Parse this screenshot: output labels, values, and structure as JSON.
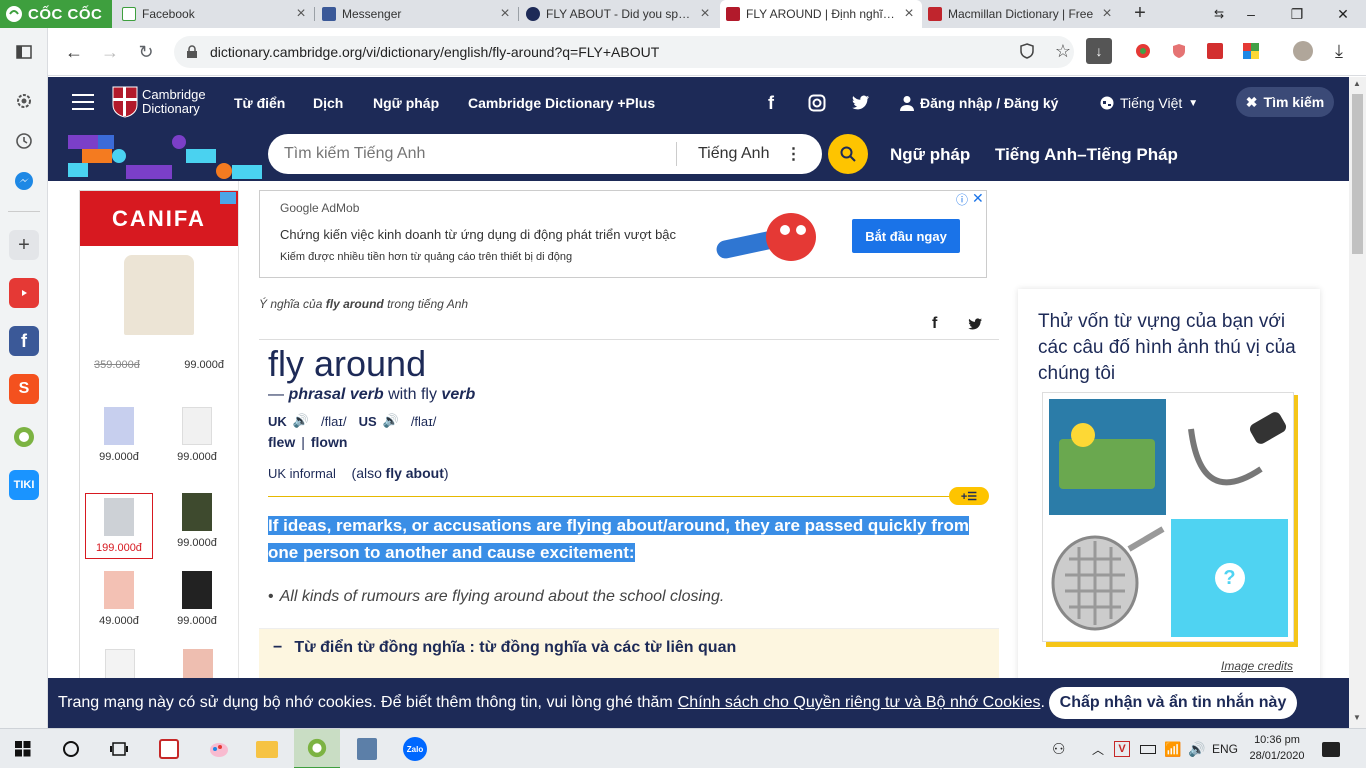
{
  "browser": {
    "brand": "CỐC CỐC",
    "tabs": [
      {
        "title": "Facebook"
      },
      {
        "title": "Messenger"
      },
      {
        "title": "FLY ABOUT - Did you spell it"
      },
      {
        "title": "FLY AROUND | Định nghĩa tr"
      },
      {
        "title": "Macmillan Dictionary | Free"
      }
    ],
    "active_tab": 3,
    "new_tab": "+",
    "window_controls": [
      "–",
      "❐",
      "✕"
    ],
    "url": "dictionary.cambridge.org/vi/dictionary/english/fly-around?q=FLY+ABOUT"
  },
  "header": {
    "logo_line1": "Cambridge",
    "logo_line2": "Dictionary",
    "nav": [
      "Từ điển",
      "Dịch",
      "Ngữ pháp",
      "Cambridge Dictionary +Plus"
    ],
    "login": "Đăng nhập / Đăng ký",
    "language": "Tiếng Việt",
    "search_toggle": "Tìm kiếm"
  },
  "searchbar": {
    "placeholder": "Tìm kiếm Tiếng Anh",
    "dictionary": "Tiếng Anh",
    "links": [
      "Ngữ pháp",
      "Tiếng Anh–Tiếng Pháp"
    ]
  },
  "ad_left": {
    "brand": "CANIFA",
    "products": [
      {
        "old_price": "359.000đ",
        "price": "99.000đ"
      },
      {
        "price": "99.000đ"
      },
      {
        "price": "99.000đ"
      },
      {
        "price": "199.000đ"
      },
      {
        "price": "99.000đ"
      },
      {
        "price": "49.000đ"
      },
      {
        "price": "99.000đ"
      }
    ]
  },
  "ad_banner": {
    "provider": "Google AdMob",
    "headline": "Chứng kiến việc kinh doanh từ ứng dụng di động phát triển vượt bậc",
    "subline": "Kiếm được nhiều tiền hơn từ quảng cáo trên thiết bị di động",
    "cta": "Bắt đầu ngay"
  },
  "entry": {
    "breadcrumb_prefix": "Ý nghĩa của",
    "breadcrumb_word": "fly around",
    "breadcrumb_suffix": "trong tiếng Anh",
    "headword": "fly around",
    "pos_dash": "—",
    "pos": "phrasal verb",
    "pos_with": "with fly",
    "pos_verb": "verb",
    "uk_label": "UK",
    "uk_ipa": "/flaɪ/",
    "us_label": "US",
    "us_ipa": "/flaɪ/",
    "forms": [
      "flew",
      "flown"
    ],
    "forms_sep": "|",
    "register": "UK informal",
    "also_prefix": "(also",
    "also_word": "fly about",
    "also_suffix": ")",
    "definition": "If ideas, remarks, or accusations are flying about/around, they are passed quickly from one person to another and cause excitement:",
    "example": "All kinds of rumours are flying around about the school closing.",
    "thesaurus": "Từ điển từ đồng nghĩa : từ đồng nghĩa và các từ liên quan"
  },
  "quiz": {
    "title": "Thử vốn từ vựng của bạn với các câu đố hình ảnh thú vị của chúng tôi",
    "credits": "Image credits",
    "unknown": "?"
  },
  "cookie": {
    "text": "Trang mạng này có sử dụng bộ nhớ cookies. Để biết thêm thông tin, vui lòng ghé thăm",
    "link": "Chính sách cho Quyền riêng tư và Bộ nhớ Cookies",
    "end": ".",
    "button": "Chấp nhận và ẩn tin nhắn này"
  },
  "taskbar": {
    "language": "ENG",
    "time": "10:36 pm",
    "date": "28/01/2020",
    "zalo": "Zalo"
  },
  "colors": {
    "cambridge_navy": "#1d2a57",
    "cambridge_yellow": "#fec400",
    "selection_blue": "#3a8ee6",
    "coccoc_green": "#3e9f3e",
    "canifa_red": "#d71920"
  }
}
